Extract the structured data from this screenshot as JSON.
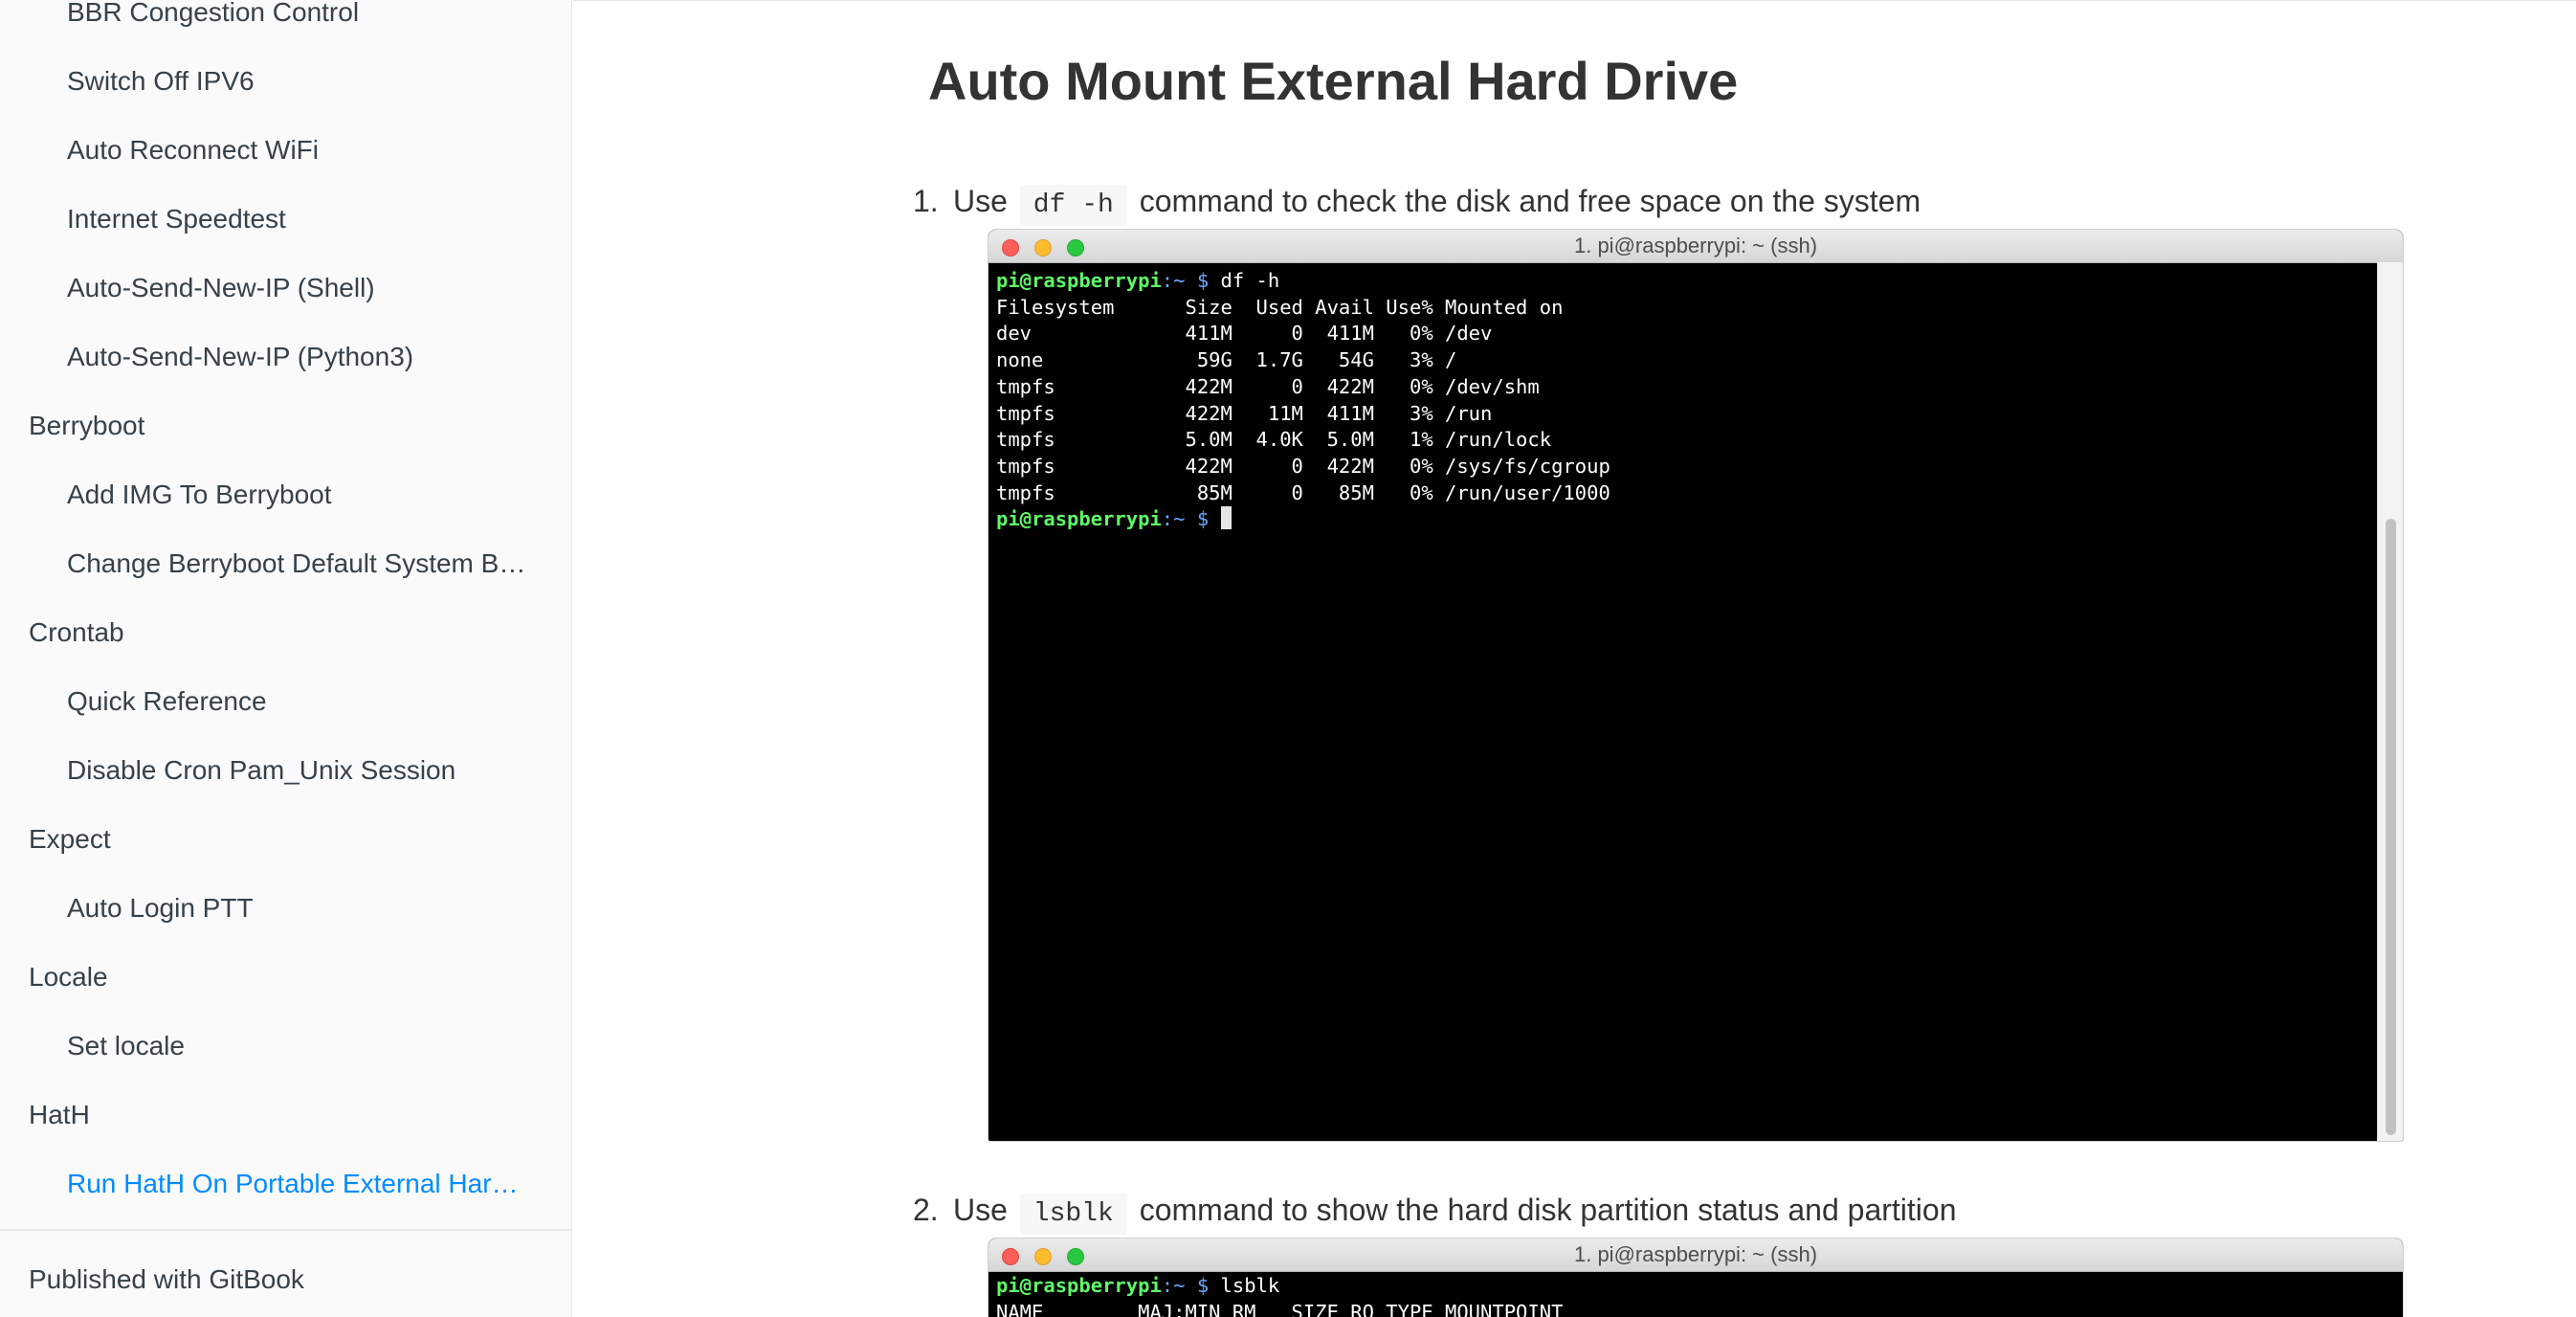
{
  "sidebar": {
    "items": [
      {
        "label": "BBR Congestion Control",
        "level": 2
      },
      {
        "label": "Switch Off IPV6",
        "level": 2
      },
      {
        "label": "Auto Reconnect WiFi",
        "level": 2
      },
      {
        "label": "Internet Speedtest",
        "level": 2
      },
      {
        "label": "Auto-Send-New-IP (Shell)",
        "level": 2
      },
      {
        "label": "Auto-Send-New-IP (Python3)",
        "level": 2
      },
      {
        "label": "Berryboot",
        "level": 1
      },
      {
        "label": "Add IMG To Berryboot",
        "level": 2
      },
      {
        "label": "Change Berryboot Default System B…",
        "level": 2
      },
      {
        "label": "Crontab",
        "level": 1
      },
      {
        "label": "Quick Reference",
        "level": 2
      },
      {
        "label": "Disable Cron Pam_Unix Session",
        "level": 2
      },
      {
        "label": "Expect",
        "level": 1
      },
      {
        "label": "Auto Login PTT",
        "level": 2
      },
      {
        "label": "Locale",
        "level": 1
      },
      {
        "label": "Set locale",
        "level": 2
      },
      {
        "label": "HatH",
        "level": 1
      },
      {
        "label": "Run HatH On Portable External Har…",
        "level": 2,
        "active": true
      }
    ],
    "footer": "Published with GitBook",
    "active_color": "#008cff"
  },
  "main": {
    "title": "Auto Mount External Hard Drive",
    "steps": [
      {
        "number": "1.",
        "before": "Use",
        "code": "df -h",
        "after": "command to check the disk and free space on the system",
        "terminal": {
          "title": "1. pi@raspberrypi: ~ (ssh)",
          "prompt_user": "pi@raspberrypi",
          "prompt_sym": ":~ $",
          "command": "df -h",
          "output": [
            "Filesystem      Size  Used Avail Use% Mounted on",
            "dev             411M     0  411M   0% /dev",
            "none             59G  1.7G   54G   3% /",
            "tmpfs           422M     0  422M   0% /dev/shm",
            "tmpfs           422M   11M  411M   3% /run",
            "tmpfs           5.0M  4.0K  5.0M   1% /run/lock",
            "tmpfs           422M     0  422M   0% /sys/fs/cgroup",
            "tmpfs            85M     0   85M   0% /run/user/1000"
          ]
        }
      },
      {
        "number": "2.",
        "before": "Use",
        "code": "lsblk",
        "after": "command to show the hard disk partition status and partition",
        "terminal": {
          "title": "1. pi@raspberrypi: ~ (ssh)",
          "prompt_user": "pi@raspberrypi",
          "prompt_sym": ":~ $",
          "command": "lsblk",
          "output": [
            "NAME        MAJ:MIN RM   SIZE RO TYPE MOUNTPOINT"
          ]
        }
      }
    ]
  }
}
